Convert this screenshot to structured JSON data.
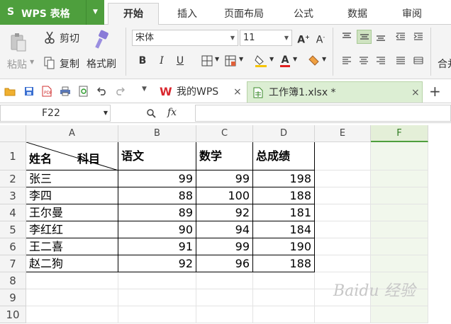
{
  "app": {
    "logo": "S",
    "name": "WPS 表格"
  },
  "menu_tabs": [
    "开始",
    "插入",
    "页面布局",
    "公式",
    "数据",
    "审阅"
  ],
  "ribbon": {
    "paste": "粘贴",
    "cut": "剪切",
    "copy": "复制",
    "format_painter": "格式刷",
    "font_name": "宋体",
    "font_size": "11",
    "bold": "B",
    "italic": "I",
    "underline": "U",
    "merge_center": "合并"
  },
  "doc_tabs": [
    {
      "label": "我的WPS",
      "close": "×"
    },
    {
      "label": "工作簿1.xlsx *",
      "close": "×"
    }
  ],
  "add_tab": "+",
  "formula_bar": {
    "name_box": "F22",
    "fx": "fx",
    "value": ""
  },
  "sheet": {
    "columns": [
      "A",
      "B",
      "C",
      "D",
      "E",
      "F"
    ],
    "selected_column": "F",
    "rows": [
      "1",
      "2",
      "3",
      "4",
      "5",
      "6",
      "7",
      "8",
      "9",
      "10"
    ],
    "header_left": "姓名",
    "header_right": "科目",
    "headers": [
      "语文",
      "数学",
      "总成绩"
    ],
    "data": [
      [
        "张三",
        "99",
        "99",
        "198"
      ],
      [
        "李四",
        "88",
        "100",
        "188"
      ],
      [
        "王尔曼",
        "89",
        "92",
        "181"
      ],
      [
        "李红红",
        "90",
        "94",
        "184"
      ],
      [
        "王二喜",
        "91",
        "99",
        "190"
      ],
      [
        "赵二狗",
        "92",
        "96",
        "188"
      ]
    ]
  },
  "watermark": "Baidu 经验",
  "colors": {
    "accent": "#4e9f3d",
    "wps_red": "#d9272e",
    "tab_active": "#dceed3"
  }
}
